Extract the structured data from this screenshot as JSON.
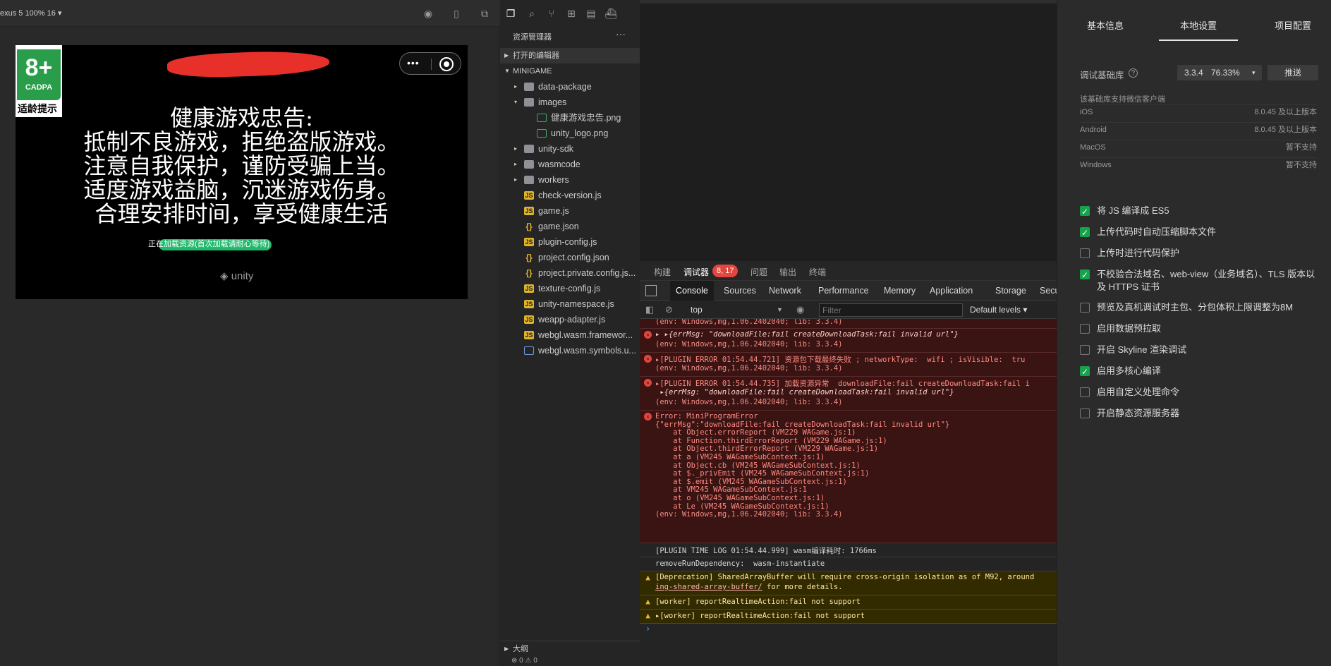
{
  "simulator": {
    "device_label": "exus 5 100% 16 ▾",
    "age_rating": "8+",
    "age_org": "CADPA",
    "age_tip": "适龄提示",
    "health_title": "健康游戏忠告:",
    "health_lines": [
      "抵制不良游戏，拒绝盗版游戏。",
      "注意自我保护，谨防受骗上当。",
      "适度游戏益脑，沉迷游戏伤身。",
      "合理安排时间，享受健康生活"
    ],
    "loading_text": "正在加载资源(首次加载请耐心等待)",
    "engine_logo": "unity",
    "capsule_menu": "•••"
  },
  "explorer": {
    "title": "资源管理器",
    "more": "···",
    "open_editors": "打开的编辑器",
    "project": "MINIGAME",
    "items": [
      {
        "label": "data-package",
        "kind": "folder",
        "twisty": "▸"
      },
      {
        "label": "images",
        "kind": "folder-img",
        "twisty": "▾"
      },
      {
        "label": "健康游戏忠告.png",
        "kind": "png",
        "twisty": ""
      },
      {
        "label": "unity_logo.png",
        "kind": "png",
        "twisty": ""
      },
      {
        "label": "unity-sdk",
        "kind": "folder",
        "twisty": "▸"
      },
      {
        "label": "wasmcode",
        "kind": "folder",
        "twisty": "▸"
      },
      {
        "label": "workers",
        "kind": "folder",
        "twisty": "▸"
      },
      {
        "label": "check-version.js",
        "kind": "js",
        "twisty": ""
      },
      {
        "label": "game.js",
        "kind": "js",
        "twisty": ""
      },
      {
        "label": "game.json",
        "kind": "json",
        "twisty": ""
      },
      {
        "label": "plugin-config.js",
        "kind": "js",
        "twisty": ""
      },
      {
        "label": "project.config.json",
        "kind": "json",
        "twisty": ""
      },
      {
        "label": "project.private.config.js...",
        "kind": "json",
        "twisty": ""
      },
      {
        "label": "texture-config.js",
        "kind": "js",
        "twisty": ""
      },
      {
        "label": "unity-namespace.js",
        "kind": "js",
        "twisty": ""
      },
      {
        "label": "weapp-adapter.js",
        "kind": "js",
        "twisty": ""
      },
      {
        "label": "webgl.wasm.framewor...",
        "kind": "js",
        "twisty": ""
      },
      {
        "label": "webgl.wasm.symbols.u...",
        "kind": "doc",
        "twisty": ""
      }
    ],
    "outline": "大纲",
    "status": "⊗ 0 ⚠ 0"
  },
  "debugger": {
    "tabs": [
      "构建",
      "调试器",
      "问题",
      "输出",
      "终端"
    ],
    "badge": "8, 17",
    "devtools_tabs": [
      "Console",
      "Sources",
      "Network",
      "Performance",
      "Memory",
      "Application",
      "Storage",
      "Securi"
    ],
    "context": "top",
    "filter_placeholder": "Filter",
    "levels": "Default levels ▾",
    "logs": {
      "l0_env": "(env: Windows,mg,1.06.2402040; lib: 3.3.4)",
      "l1_msg": "▸ ▸{errMsg: \"downloadFile:fail createDownloadTask:fail invalid url\"}",
      "l1_env": "(env: Windows,mg,1.06.2402040; lib: 3.3.4)",
      "l2_msg": "▸[PLUGIN ERROR 01:54.44.721] 资源包下载最终失败 ; networkType:  wifi ; isVisible:  tru",
      "l2_env": "(env: Windows,mg,1.06.2402040; lib: 3.3.4)",
      "l3_msg": "▸[PLUGIN ERROR 01:54.44.735] 加载资源异常  downloadFile:fail createDownloadTask:fail i",
      "l3_sub": " ▸{errMsg: \"downloadFile:fail createDownloadTask:fail invalid url\"}",
      "l3_env": "(env: Windows,mg,1.06.2402040; lib: 3.3.4)",
      "l4_lines": [
        "Error: MiniProgramError",
        "{\"errMsg\":\"downloadFile:fail createDownloadTask:fail invalid url\"}",
        "    at Object.errorReport (VM229 WAGame.js:1)",
        "    at Function.thirdErrorReport (VM229 WAGame.js:1)",
        "    at Object.thirdErrorReport (VM229 WAGame.js:1)",
        "    at a (VM245 WAGameSubContext.js:1)",
        "    at Object.cb (VM245 WAGameSubContext.js:1)",
        "    at $._privEmit (VM245 WAGameSubContext.js:1)",
        "    at $.emit (VM245 WAGameSubContext.js:1)",
        "    at VM245 WAGameSubContext.js:1",
        "    at o (VM245 WAGameSubContext.js:1)",
        "    at Le (VM245 WAGameSubContext.js:1)",
        "(env: Windows,mg,1.06.2402040; lib: 3.3.4)"
      ],
      "l5_msg": "[PLUGIN TIME LOG 01:54.44.999] wasm编译耗时: 1766ms",
      "l6_msg": "removeRunDependency:  wasm-instantiate",
      "l7_msg": "[Deprecation] SharedArrayBuffer will require cross-origin isolation as of M92, around",
      "l7_link": "ing-shared-array-buffer/",
      "l7_tail": " for more details.",
      "l8_msg": "[worker] reportRealtimeAction:fail not support",
      "l9_msg": "▸[worker] reportRealtimeAction:fail not support"
    },
    "prompt": "›"
  },
  "settings": {
    "tabs": [
      "基本信息",
      "本地设置",
      "项目配置"
    ],
    "lib_label": "调试基础库",
    "lib_help": "?",
    "lib_version": "3.3.4",
    "lib_percent": "76.33%",
    "lib_caret": "▾",
    "push_label": "推送",
    "support_label": "该基础库支持微信客户端",
    "platforms": [
      {
        "name": "iOS",
        "value": "8.0.45 及以上版本"
      },
      {
        "name": "Android",
        "value": "8.0.45 及以上版本"
      },
      {
        "name": "MacOS",
        "value": "暂不支持"
      },
      {
        "name": "Windows",
        "value": "暂不支持"
      }
    ],
    "options": [
      {
        "label": "将 JS 编译成 ES5",
        "checked": true
      },
      {
        "label": "上传代码时自动压缩脚本文件",
        "checked": true
      },
      {
        "label": "上传时进行代码保护",
        "checked": false
      },
      {
        "label": "不校验合法域名、web-view（业务域名）、TLS 版本以及 HTTPS 证书",
        "checked": true
      },
      {
        "label": "预览及真机调试时主包、分包体积上限调整为8M",
        "checked": false
      },
      {
        "label": "启用数据预拉取",
        "checked": false
      },
      {
        "label": "开启 Skyline 渲染调试",
        "checked": false
      },
      {
        "label": "启用多核心编译",
        "checked": true
      },
      {
        "label": "启用自定义处理命令",
        "checked": false
      },
      {
        "label": "开启静态资源服务器",
        "checked": false
      }
    ]
  }
}
